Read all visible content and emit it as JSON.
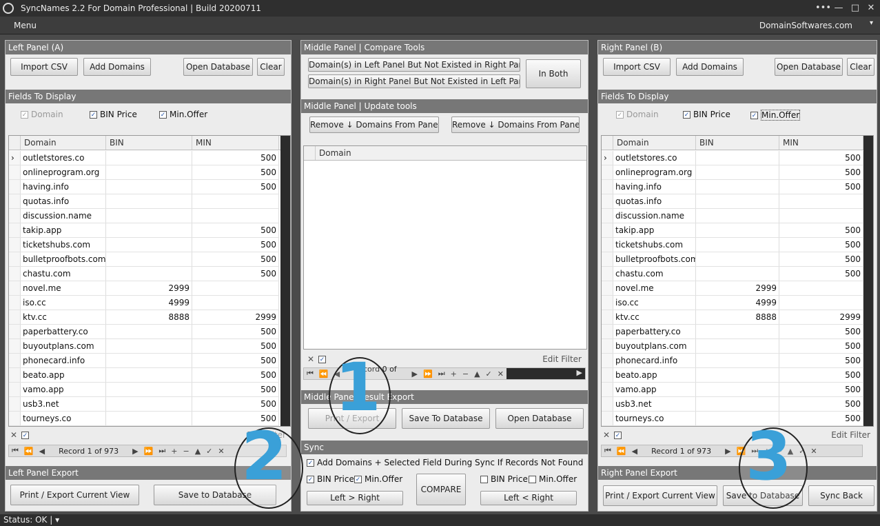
{
  "window": {
    "title": "SyncNames 2.2 For Domain Professional  |  Build 20200711",
    "controls": [
      "•••",
      "—",
      "□",
      "✕"
    ]
  },
  "menubar": {
    "menu": "Menu",
    "site": "DomainSoftwares.com"
  },
  "left": {
    "header": "Left Panel (A)",
    "buttons": {
      "import": "Import CSV",
      "add": "Add Domains",
      "open": "Open Database",
      "clear": "Clear"
    },
    "fields_header": "Fields To Display",
    "fields": {
      "domain": "Domain",
      "bin": "BIN Price",
      "min": "Min.Offer"
    },
    "columns": [
      "Domain",
      "BIN",
      "MIN"
    ],
    "record": "Record 1 of 973",
    "edit_filter": "Edit Filter",
    "export_header": "Left Panel Export",
    "print": "Print / Export Current View",
    "save": "Save to Database"
  },
  "right": {
    "header": "Right Panel (B)",
    "buttons": {
      "import": "Import CSV",
      "add": "Add Domains",
      "open": "Open Database",
      "clear": "Clear"
    },
    "fields_header": "Fields To Display",
    "fields": {
      "domain": "Domain",
      "bin": "BIN Price",
      "min": "Min.Offer"
    },
    "columns": [
      "Domain",
      "BIN",
      "MIN"
    ],
    "record": "Record 1 of 973",
    "edit_filter": "Edit Filter",
    "export_header": "Right Panel Export",
    "print": "Print / Export Current View",
    "save": "Save to Database",
    "sync": "Sync Back"
  },
  "middle": {
    "compare_header": "Middle Panel | Compare Tools",
    "not_in_right": "Domain(s) in Left Panel But Not Existed in Right Panel",
    "not_in_left": "Domain(s) in Right Panel But Not Existed in Left Panel",
    "in_both": "In Both",
    "update_header": "Middle Panel | Update tools",
    "remove_a": "Remove ↓ Domains From Panel A",
    "remove_b": "Remove ↓ Domains From Panel B",
    "column": "Domain",
    "edit_filter": "Edit Filter",
    "record": "Record 0 of 0",
    "export_header": "Middle Panel Result Export",
    "print": "Print / Export",
    "save": "Save To Database",
    "open": "Open Database",
    "sync_header": "Sync",
    "sync_add": "Add Domains + Selected Field During Sync If Records Not Found",
    "bin": "BIN Price",
    "min": "Min.Offer",
    "compare": "COMPARE",
    "l2r": "Left > Right",
    "r2l": "Left < Right"
  },
  "rows": [
    {
      "domain": "outletstores.co",
      "bin": "",
      "min": "500"
    },
    {
      "domain": "onlineprogram.org",
      "bin": "",
      "min": "500"
    },
    {
      "domain": "having.info",
      "bin": "",
      "min": "500"
    },
    {
      "domain": "quotas.info",
      "bin": "",
      "min": ""
    },
    {
      "domain": "discussion.name",
      "bin": "",
      "min": ""
    },
    {
      "domain": "takip.app",
      "bin": "",
      "min": "500"
    },
    {
      "domain": "ticketshubs.com",
      "bin": "",
      "min": "500"
    },
    {
      "domain": "bulletproofbots.com",
      "bin": "",
      "min": "500"
    },
    {
      "domain": "chastu.com",
      "bin": "",
      "min": "500"
    },
    {
      "domain": "novel.me",
      "bin": "2999",
      "min": ""
    },
    {
      "domain": "iso.cc",
      "bin": "4999",
      "min": ""
    },
    {
      "domain": "ktv.cc",
      "bin": "8888",
      "min": "2999"
    },
    {
      "domain": "paperbattery.co",
      "bin": "",
      "min": "500"
    },
    {
      "domain": "buyoutplans.com",
      "bin": "",
      "min": "500"
    },
    {
      "domain": "phonecard.info",
      "bin": "",
      "min": "500"
    },
    {
      "domain": "beato.app",
      "bin": "",
      "min": "500"
    },
    {
      "domain": "vamo.app",
      "bin": "",
      "min": "500"
    },
    {
      "domain": "usb3.net",
      "bin": "",
      "min": "500"
    },
    {
      "domain": "tourneys.co",
      "bin": "",
      "min": "500"
    }
  ],
  "callouts": [
    "1",
    "2",
    "3"
  ],
  "status": "Status: OK |"
}
